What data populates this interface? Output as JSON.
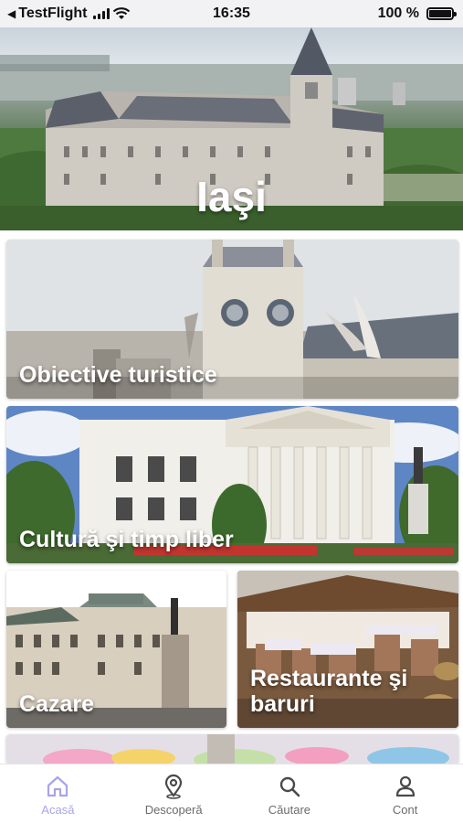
{
  "status_bar": {
    "back_app": "TestFlight",
    "time": "16:35",
    "battery": "100 %",
    "back_arrow_icon": "back-arrow-icon",
    "signal_icon": "cellular-signal-icon",
    "wifi_icon": "wifi-icon",
    "battery_icon": "battery-full-icon"
  },
  "hero": {
    "title": "Iaşi"
  },
  "categories": {
    "obiective": "Obiective turistice",
    "cultura": "Cultură şi timp liber",
    "cazare": "Cazare",
    "restaurante": "Restaurante şi baruri"
  },
  "tab_bar": {
    "active_color": "#a8a4e8",
    "inactive_color": "#6b6b6b",
    "tabs": [
      {
        "label": "Acasă",
        "icon": "home-icon"
      },
      {
        "label": "Descoperă",
        "icon": "map-pin-icon"
      },
      {
        "label": "Căutare",
        "icon": "search-icon"
      },
      {
        "label": "Cont",
        "icon": "user-icon"
      }
    ]
  }
}
